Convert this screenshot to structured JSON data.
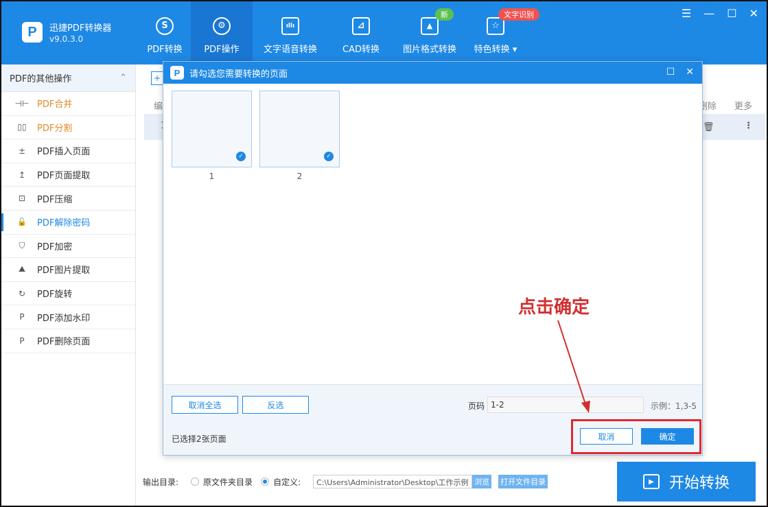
{
  "app": {
    "logo": "P",
    "name": "迅捷PDF转换器",
    "version": "v9.0.3.0"
  },
  "toolbar": [
    {
      "label": "PDF转换",
      "icon": "S"
    },
    {
      "label": "PDF操作",
      "icon": "⚙"
    },
    {
      "label": "文字语音转换",
      "icon": "ıllı"
    },
    {
      "label": "CAD转换",
      "icon": "⊿"
    },
    {
      "label": "图片格式转换",
      "icon": "▲"
    },
    {
      "label": "特色转换 ▾",
      "icon": "☆"
    }
  ],
  "badges": {
    "new": "新",
    "ocr": "文字识别"
  },
  "window_controls": {
    "menu": "☰",
    "min": "—",
    "max": "☐",
    "close": "✕"
  },
  "sidebar": {
    "header": "PDF的其他操作",
    "header_icon": "⌃",
    "items": [
      {
        "label": "PDF合并",
        "icon": "⊣⊢"
      },
      {
        "label": "PDF分割",
        "icon": "▯▯"
      },
      {
        "label": "PDF插入页面",
        "icon": "±"
      },
      {
        "label": "PDF页面提取",
        "icon": "↥"
      },
      {
        "label": "PDF压缩",
        "icon": "⊡"
      },
      {
        "label": "PDF解除密码",
        "icon": "🔓"
      },
      {
        "label": "PDF加密",
        "icon": "⛉"
      },
      {
        "label": "PDF图片提取",
        "icon": "⛰"
      },
      {
        "label": "PDF旋转",
        "icon": "↻"
      },
      {
        "label": "PDF添加水印",
        "icon": "P"
      },
      {
        "label": "PDF删除页面",
        "icon": "P"
      }
    ]
  },
  "background": {
    "col_bian": "编",
    "col_delete": "删除",
    "col_more": "更多",
    "row_index": "1",
    "trash": "🗑",
    "dots": "⋮",
    "add": "+"
  },
  "output": {
    "label": "输出目录:",
    "opt_original": "原文件夹目录",
    "opt_custom": "自定义:",
    "path": "C:\\Users\\Administrator\\Desktop\\工作示例",
    "browse": "浏览",
    "open_dir": "打开文件目录"
  },
  "start_button": {
    "label": "开始转换",
    "icon": "▶"
  },
  "modal": {
    "logo": "P",
    "title": "请勾选您需要转换的页面",
    "max": "☐",
    "close": "✕",
    "pages": [
      "1",
      "2"
    ],
    "check": "✓",
    "deselect_all": "取消全选",
    "invert": "反选",
    "page_label": "页码",
    "page_value": "1-2",
    "example": "示例：1,3-5",
    "selected_count": "已选择2张页面",
    "cancel": "取消",
    "confirm": "确定"
  },
  "annotation": {
    "text": "点击确定",
    "color": "#d32f2f"
  },
  "colors": {
    "primary": "#1e88e5",
    "accent_orange": "#e08a28"
  }
}
